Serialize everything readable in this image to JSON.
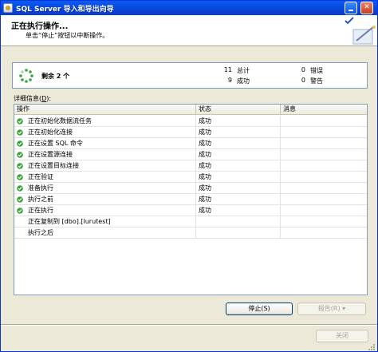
{
  "window": {
    "title": "SQL Server 导入和导出向导"
  },
  "header": {
    "title": "正在执行操作...",
    "subtitle": "单击“停止”按钮以中断操作。"
  },
  "summary": {
    "remaining": "剩余 2 个",
    "total_count": "11",
    "total_label": "总计",
    "success_count": "9",
    "success_label": "成功",
    "error_count": "0",
    "error_label": "错误",
    "warning_count": "0",
    "warning_label": "警告"
  },
  "details": {
    "label_prefix": "详细信息(",
    "label_key": "D",
    "label_suffix": "):"
  },
  "table": {
    "columns": [
      "操作",
      "状态",
      "消息"
    ],
    "rows": [
      {
        "action": "正在初始化数据流任务",
        "status": "成功",
        "message": "",
        "done": true
      },
      {
        "action": "正在初始化连接",
        "status": "成功",
        "message": "",
        "done": true
      },
      {
        "action": "正在设置 SQL 命令",
        "status": "成功",
        "message": "",
        "done": true
      },
      {
        "action": "正在设置源连接",
        "status": "成功",
        "message": "",
        "done": true
      },
      {
        "action": "正在设置目标连接",
        "status": "成功",
        "message": "",
        "done": true
      },
      {
        "action": "正在验证",
        "status": "成功",
        "message": "",
        "done": true
      },
      {
        "action": "准备执行",
        "status": "成功",
        "message": "",
        "done": true
      },
      {
        "action": "执行之前",
        "status": "成功",
        "message": "",
        "done": true
      },
      {
        "action": "正在执行",
        "status": "成功",
        "message": "",
        "done": true
      },
      {
        "action": "正在复制到 [dbo].[lurutest]",
        "status": "",
        "message": "",
        "done": false
      },
      {
        "action": "执行之后",
        "status": "",
        "message": "",
        "done": false
      }
    ]
  },
  "buttons": {
    "stop": "停止(S)",
    "report": "报告(R)",
    "close": "关闭"
  },
  "colors": {
    "title_bar": "#0a5bf5",
    "success_green": "#3ca33c"
  }
}
